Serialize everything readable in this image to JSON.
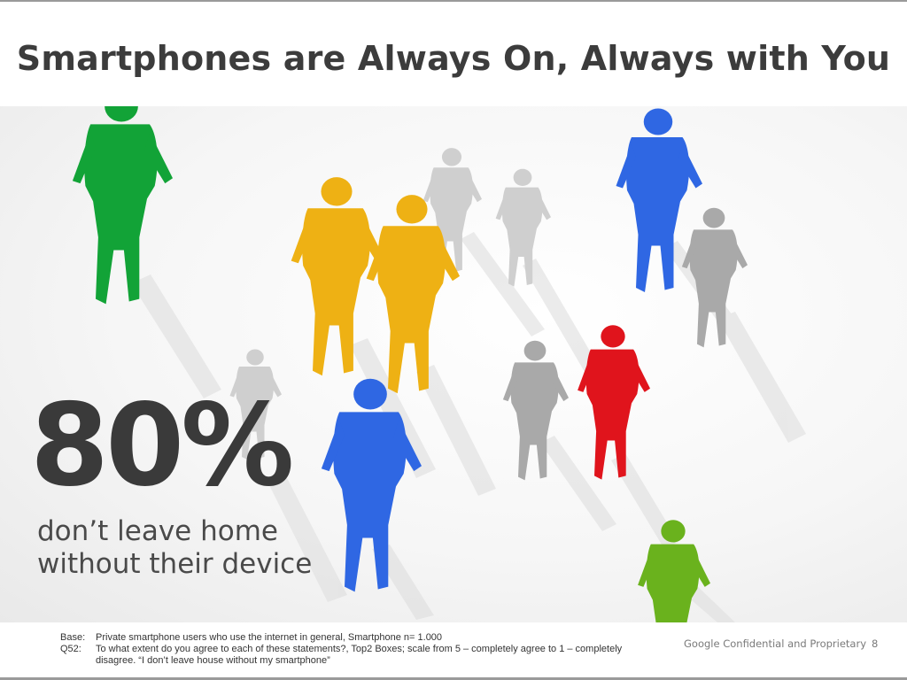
{
  "slide": {
    "title": "Smartphones are Always On, Always with You",
    "stat": {
      "value": "80%",
      "line1": "don’t leave home",
      "line2": "without their device"
    },
    "footnote": {
      "base_label": "Base:",
      "base_text": "Private smartphone users who use the internet in general, Smartphone n= 1.000",
      "q_label": "Q52:",
      "q_text": "To what extent do you agree to each of these statements?, Top2 Boxes; scale from 5 – completely agree to 1 – completely disagree. “I don’t leave house without my smartphone”"
    },
    "confidential": "Google Confidential and Proprietary",
    "page_number": "8"
  },
  "colors": {
    "green": "#12a337",
    "yellow": "#eeb114",
    "blue": "#2f67e3",
    "red": "#e0141c",
    "light_green": "#6ab21d",
    "gray": "#a9a9a9",
    "ghost": "#cfcfcf"
  }
}
